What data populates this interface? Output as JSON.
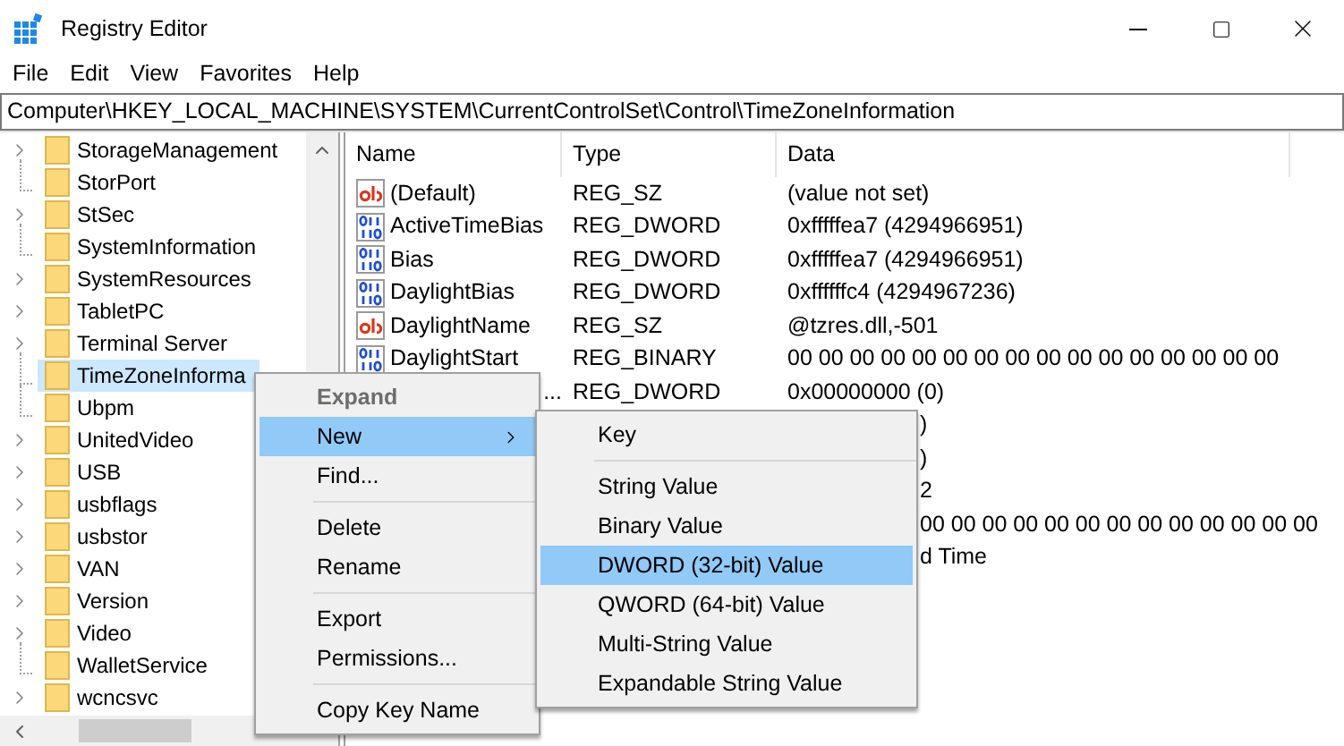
{
  "window": {
    "title": "Registry Editor"
  },
  "menu_bar": [
    "File",
    "Edit",
    "View",
    "Favorites",
    "Help"
  ],
  "address_bar": {
    "value": "Computer\\HKEY_LOCAL_MACHINE\\SYSTEM\\CurrentControlSet\\Control\\TimeZoneInformation"
  },
  "tree": {
    "items": [
      {
        "label": "StorageManagement",
        "expandable": true,
        "selected": false
      },
      {
        "label": "StorPort",
        "expandable": false,
        "selected": false
      },
      {
        "label": "StSec",
        "expandable": true,
        "selected": false
      },
      {
        "label": "SystemInformation",
        "expandable": false,
        "selected": false
      },
      {
        "label": "SystemResources",
        "expandable": true,
        "selected": false
      },
      {
        "label": "TabletPC",
        "expandable": true,
        "selected": false
      },
      {
        "label": "Terminal Server",
        "expandable": true,
        "selected": false
      },
      {
        "label": "TimeZoneInforma",
        "expandable": false,
        "selected": true
      },
      {
        "label": "Ubpm",
        "expandable": false,
        "selected": false
      },
      {
        "label": "UnitedVideo",
        "expandable": true,
        "selected": false
      },
      {
        "label": "USB",
        "expandable": true,
        "selected": false
      },
      {
        "label": "usbflags",
        "expandable": true,
        "selected": false
      },
      {
        "label": "usbstor",
        "expandable": true,
        "selected": false
      },
      {
        "label": "VAN",
        "expandable": true,
        "selected": false
      },
      {
        "label": "Version",
        "expandable": true,
        "selected": false
      },
      {
        "label": "Video",
        "expandable": true,
        "selected": false
      },
      {
        "label": "WalletService",
        "expandable": false,
        "selected": false
      },
      {
        "label": "wcncsvc",
        "expandable": true,
        "selected": false
      }
    ]
  },
  "values_table": {
    "columns": [
      "Name",
      "Type",
      "Data"
    ],
    "rows": [
      {
        "kind": "string",
        "name": "(Default)",
        "type": "REG_SZ",
        "data": "(value not set)"
      },
      {
        "kind": "dword",
        "name": "ActiveTimeBias",
        "type": "REG_DWORD",
        "data": "0xfffffea7 (4294966951)"
      },
      {
        "kind": "dword",
        "name": "Bias",
        "type": "REG_DWORD",
        "data": "0xfffffea7 (4294966951)"
      },
      {
        "kind": "dword",
        "name": "DaylightBias",
        "type": "REG_DWORD",
        "data": "0xffffffc4 (4294967236)"
      },
      {
        "kind": "string",
        "name": "DaylightName",
        "type": "REG_SZ",
        "data": "@tzres.dll,-501"
      },
      {
        "kind": "dword",
        "name": "DaylightStart",
        "type": "REG_BINARY",
        "data": "00 00 00 00 00 00 00 00 00 00 00 00 00 00 00 00"
      },
      {
        "name": "...",
        "type": "REG_DWORD",
        "data": "0x00000000 (0)"
      },
      {
        "data": ")"
      },
      {
        "data": ")"
      },
      {
        "data": "2"
      },
      {
        "data": "00 00 00 00 00 00 00 00 00 00 00 00 00"
      },
      {
        "data": "d Time"
      }
    ]
  },
  "context_menu": {
    "items": [
      {
        "kind": "item",
        "label": "Expand",
        "disabled": true,
        "selected": false,
        "submenu": false
      },
      {
        "kind": "item",
        "label": "New",
        "disabled": false,
        "selected": true,
        "submenu": true
      },
      {
        "kind": "item",
        "label": "Find...",
        "disabled": false,
        "selected": false,
        "submenu": false
      },
      {
        "kind": "separator"
      },
      {
        "kind": "item",
        "label": "Delete",
        "disabled": false,
        "selected": false,
        "submenu": false
      },
      {
        "kind": "item",
        "label": "Rename",
        "disabled": false,
        "selected": false,
        "submenu": false
      },
      {
        "kind": "separator"
      },
      {
        "kind": "item",
        "label": "Export",
        "disabled": false,
        "selected": false,
        "submenu": false
      },
      {
        "kind": "item",
        "label": "Permissions...",
        "disabled": false,
        "selected": false,
        "submenu": false
      },
      {
        "kind": "separator"
      },
      {
        "kind": "item",
        "label": "Copy Key Name",
        "disabled": false,
        "selected": false,
        "submenu": false
      }
    ]
  },
  "submenu": {
    "items": [
      {
        "kind": "item",
        "label": "Key",
        "selected": false
      },
      {
        "kind": "separator"
      },
      {
        "kind": "item",
        "label": "String Value",
        "selected": false
      },
      {
        "kind": "item",
        "label": "Binary Value",
        "selected": false
      },
      {
        "kind": "item",
        "label": "DWORD (32-bit) Value",
        "selected": true
      },
      {
        "kind": "item",
        "label": "QWORD (64-bit) Value",
        "selected": false
      },
      {
        "kind": "item",
        "label": "Multi-String Value",
        "selected": false
      },
      {
        "kind": "item",
        "label": "Expandable String Value",
        "selected": false
      }
    ]
  }
}
